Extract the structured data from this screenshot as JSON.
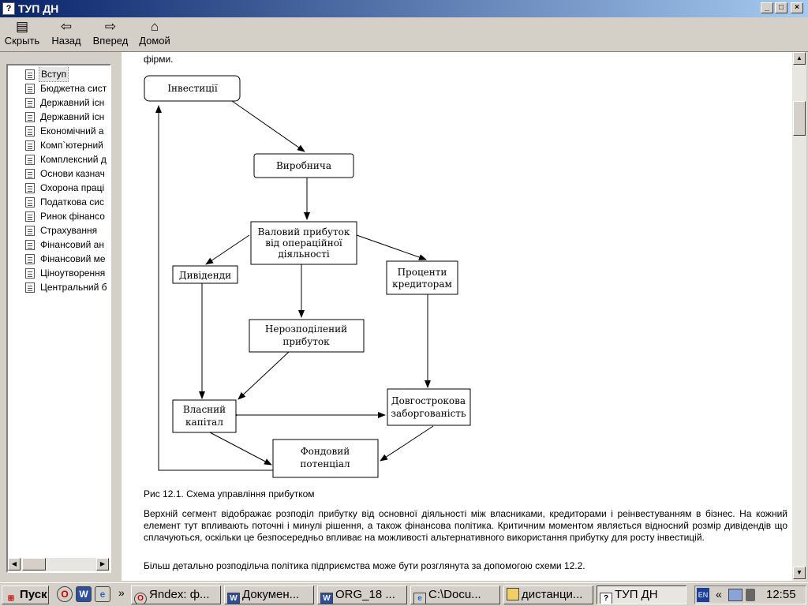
{
  "window": {
    "title": "ТУП ДН",
    "title_icon": "help-book-icon",
    "controls": {
      "minimize": "_",
      "maximize": "□",
      "close": "×"
    }
  },
  "toolbar": {
    "hide": {
      "label": "Скрыть",
      "icon": "hide-pane-icon"
    },
    "back": {
      "label": "Назад",
      "icon": "arrow-left-icon"
    },
    "forward": {
      "label": "Вперед",
      "icon": "arrow-right-icon"
    },
    "home": {
      "label": "Домой",
      "icon": "home-icon"
    }
  },
  "nav": {
    "items": [
      {
        "label": "Вступ",
        "selected": true
      },
      {
        "label": "Бюджетна сист"
      },
      {
        "label": "Державний існ"
      },
      {
        "label": "Державний існ"
      },
      {
        "label": "Економічний а"
      },
      {
        "label": "Комп`ютерний"
      },
      {
        "label": "Комплексний д"
      },
      {
        "label": "Основи казнач"
      },
      {
        "label": "Охорона праці"
      },
      {
        "label": "Податкова сис"
      },
      {
        "label": "Ринок фінансо"
      },
      {
        "label": "Страхування"
      },
      {
        "label": "Фінансовий ан"
      },
      {
        "label": "Фінансовий ме"
      },
      {
        "label": "Ціноутворення"
      },
      {
        "label": "Центральний б"
      }
    ]
  },
  "content": {
    "top_text": "фірми.",
    "diagram": {
      "nodes": {
        "investments": "Інвестиції",
        "production": "Виробнича",
        "gross_profit": [
          "Валовий прибуток",
          "від операційної",
          "діяльності"
        ],
        "dividends": "Дивіденди",
        "interest": [
          "Проценти",
          "кредиторам"
        ],
        "retained": [
          "Нерозподілений",
          "прибуток"
        ],
        "equity": [
          "Власний",
          "капітал"
        ],
        "long_debt": [
          "Довгострокова",
          "заборгованість"
        ],
        "stock_potential": [
          "Фондовий",
          "потенціал"
        ]
      }
    },
    "caption": "Рис 12.1. Схема управління прибутком",
    "paragraph1": "Верхній сегмент відображає розподіл прибутку від основної діяльності між власниками, кредиторами і реінвестуванням в бізнес. На кожний елемент тут впливають поточні і минулі рішення, а також фінансова політика. Критичним моментом являється відносний розмір дивідендів що сплачуються, оскільки це безпосередньо впливає на можливості альтернативного використання прибутку для росту інвестицій.",
    "paragraph2": "Більш детально розподільча політика підприємства може бути розглянута за допомогою схеми 12.2."
  },
  "taskbar": {
    "start": "Пуск",
    "quicklaunch": [
      "opera-icon",
      "word-icon",
      "ie-icon"
    ],
    "chevron": "»",
    "tasks": [
      {
        "label": "Яndex: ф...",
        "icon": "opera-icon"
      },
      {
        "label": "Докумен...",
        "icon": "word-icon"
      },
      {
        "label": "ORG_18 ...",
        "icon": "word-icon"
      },
      {
        "label": "C:\\Docu...",
        "icon": "explorer-icon"
      },
      {
        "label": "дистанци...",
        "icon": "folder-icon"
      },
      {
        "label": "ТУП ДН",
        "icon": "help-book-icon",
        "active": true
      }
    ],
    "lang": "EN",
    "tray_chevron": "«",
    "clock": "12:55"
  }
}
